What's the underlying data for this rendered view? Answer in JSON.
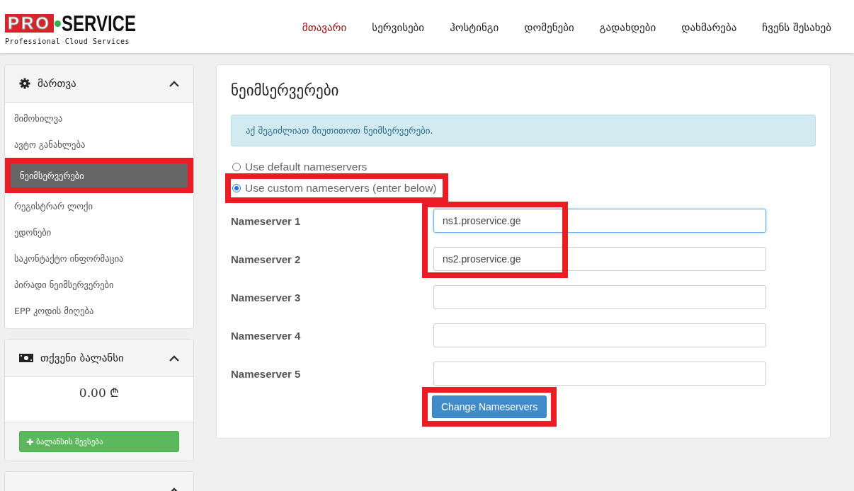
{
  "logo": {
    "brand_left": "PRO",
    "brand_right": "SERVICE",
    "tagline": "Professional Cloud Services"
  },
  "nav": [
    {
      "label": "მთავარი",
      "selected": true
    },
    {
      "label": "სერვისები",
      "selected": false
    },
    {
      "label": "ჰოსტინგი",
      "selected": false
    },
    {
      "label": "დომენები",
      "selected": false
    },
    {
      "label": "გადახდები",
      "selected": false
    },
    {
      "label": "დახმარება",
      "selected": false
    },
    {
      "label": "ჩვენს შესახებ",
      "selected": false
    }
  ],
  "sidebar": {
    "manage_panel": {
      "title": "მართვა",
      "expanded": true,
      "items": [
        {
          "label": "მიმოხილვა",
          "selected": false,
          "highlighted": false
        },
        {
          "label": "ავტო განახლება",
          "selected": false,
          "highlighted": false
        },
        {
          "label": "ნეიმსერვერები",
          "selected": true,
          "highlighted": true
        },
        {
          "label": "რეგისტრარ ლოქი",
          "selected": false,
          "highlighted": false
        },
        {
          "label": "ედონები",
          "selected": false,
          "highlighted": false
        },
        {
          "label": "საკონტაქტო ინფორმაცია",
          "selected": false,
          "highlighted": false
        },
        {
          "label": "პირადი ნეიმსერვერები",
          "selected": false,
          "highlighted": false
        },
        {
          "label": "EPP კოდის მიღება",
          "selected": false,
          "highlighted": false
        }
      ]
    },
    "balance_panel": {
      "title": "თქვენი ბალანსი",
      "expanded": true,
      "amount": "0.00 ₾",
      "button": "ბალანსის შევსება"
    },
    "third_panel": {
      "expanded": true
    }
  },
  "main": {
    "title": "ნეიმსერვერები",
    "info": "აქ შეგიძლიათ მიუთითოთ ნეიმსერვერები.",
    "options": [
      {
        "label": "Use default nameservers",
        "selected": false,
        "highlighted": false
      },
      {
        "label": "Use custom nameservers (enter below)",
        "selected": true,
        "highlighted": true
      }
    ],
    "fields": [
      {
        "label": "Nameserver 1",
        "value": "ns1.proservice.ge",
        "focused": true,
        "highlighted": true
      },
      {
        "label": "Nameserver 2",
        "value": "ns2.proservice.ge",
        "focused": false,
        "highlighted": true
      },
      {
        "label": "Nameserver 3",
        "focused": false,
        "highlighted": false
      },
      {
        "label": "Nameserver 4",
        "focused": false,
        "highlighted": false
      },
      {
        "label": "Nameserver 5",
        "focused": false,
        "highlighted": false
      }
    ],
    "submit": {
      "label": "Change Nameservers",
      "highlighted": true
    }
  }
}
